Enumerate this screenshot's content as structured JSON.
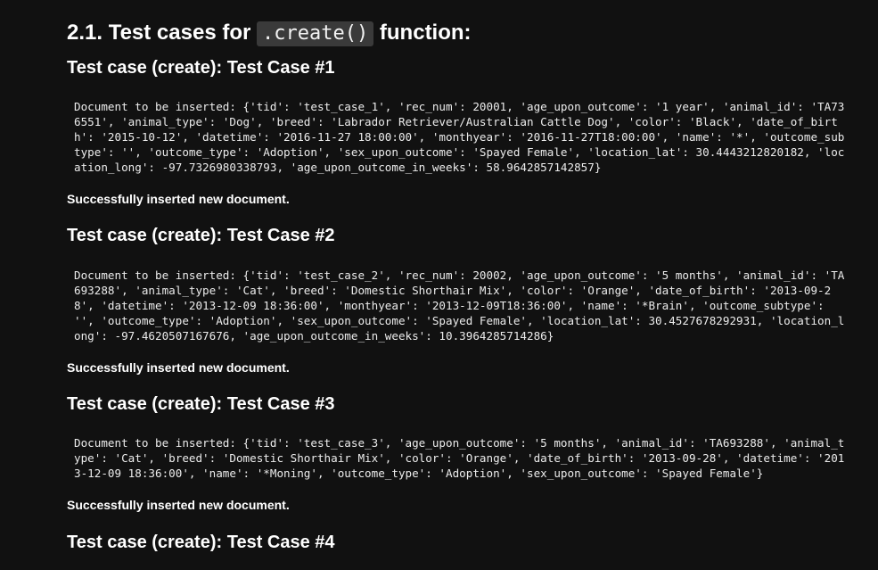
{
  "section": {
    "title_prefix": "2.1. Test cases for",
    "title_code": ".create()",
    "title_suffix": "function:"
  },
  "cases": [
    {
      "heading": "Test case (create): Test Case #1",
      "output_lines": [
        "Document to be inserted: {'tid': 'test_case_1', 'rec_num': 20001, 'age_upon_outcome': '1 year', 'animal_id': 'TA73",
        "6551', 'animal_type': 'Dog', 'breed': 'Labrador Retriever/Australian Cattle Dog', 'color': 'Black', 'date_of_birt",
        "h': '2015-10-12', 'datetime': '2016-11-27 18:00:00', 'monthyear': '2016-11-27T18:00:00', 'name': '*', 'outcome_sub",
        "type': '', 'outcome_type': 'Adoption', 'sex_upon_outcome': 'Spayed Female', 'location_lat': 30.4443212820182, 'loc",
        "ation_long': -97.7326980338793, 'age_upon_outcome_in_weeks': 58.9642857142857}"
      ],
      "status": "Successfully inserted new document."
    },
    {
      "heading": "Test case (create): Test Case #2",
      "output_lines": [
        "Document to be inserted: {'tid': 'test_case_2', 'rec_num': 20002, 'age_upon_outcome': '5 months', 'animal_id': 'TA",
        "693288', 'animal_type': 'Cat', 'breed': 'Domestic Shorthair Mix', 'color': 'Orange', 'date_of_birth': '2013-09-2",
        "8', 'datetime': '2013-12-09 18:36:00', 'monthyear': '2013-12-09T18:36:00', 'name': '*Brain', 'outcome_subtype':",
        "'', 'outcome_type': 'Adoption', 'sex_upon_outcome': 'Spayed Female', 'location_lat': 30.4527678292931, 'location_l",
        "ong': -97.4620507167676, 'age_upon_outcome_in_weeks': 10.3964285714286}"
      ],
      "status": "Successfully inserted new document."
    },
    {
      "heading": "Test case (create): Test Case #3",
      "output_lines": [
        "Document to be inserted: {'tid': 'test_case_3', 'age_upon_outcome': '5 months', 'animal_id': 'TA693288', 'animal_t",
        "ype': 'Cat', 'breed': 'Domestic Shorthair Mix', 'color': 'Orange', 'date_of_birth': '2013-09-28', 'datetime': '201",
        "3-12-09 18:36:00', 'name': '*Moning', 'outcome_type': 'Adoption', 'sex_upon_outcome': 'Spayed Female'}"
      ],
      "status": "Successfully inserted new document."
    },
    {
      "heading": "Test case (create): Test Case #4",
      "output_lines": [],
      "status": ""
    }
  ]
}
